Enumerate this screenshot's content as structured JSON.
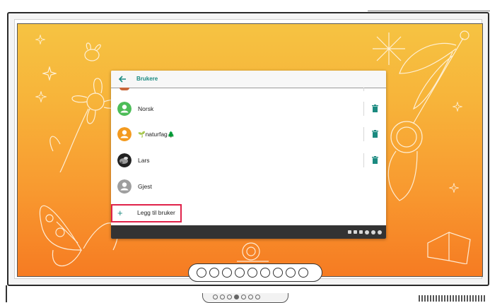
{
  "dialog": {
    "title": "Brukere",
    "users": [
      {
        "name": "Norsk",
        "avatar": "green-person-icon",
        "deletable": true
      },
      {
        "name": "🌱naturfag🌲",
        "avatar": "orange-person-icon",
        "deletable": true
      },
      {
        "name": "Lars",
        "avatar": "photo-avatar",
        "deletable": true
      },
      {
        "name": "Gjest",
        "avatar": "gray-person-icon",
        "deletable": false
      }
    ],
    "add_user_label": "Legg til bruker"
  },
  "colors": {
    "accent": "#1b8a80",
    "highlight": "#e0224a",
    "user_norsk": "#4cbd58",
    "user_naturfag": "#f39a1f",
    "user_guest": "#9e9e9e",
    "wallpaper_top": "#f6c342",
    "wallpaper_bottom": "#f67b22"
  },
  "dock": {
    "slot_count": 9
  }
}
